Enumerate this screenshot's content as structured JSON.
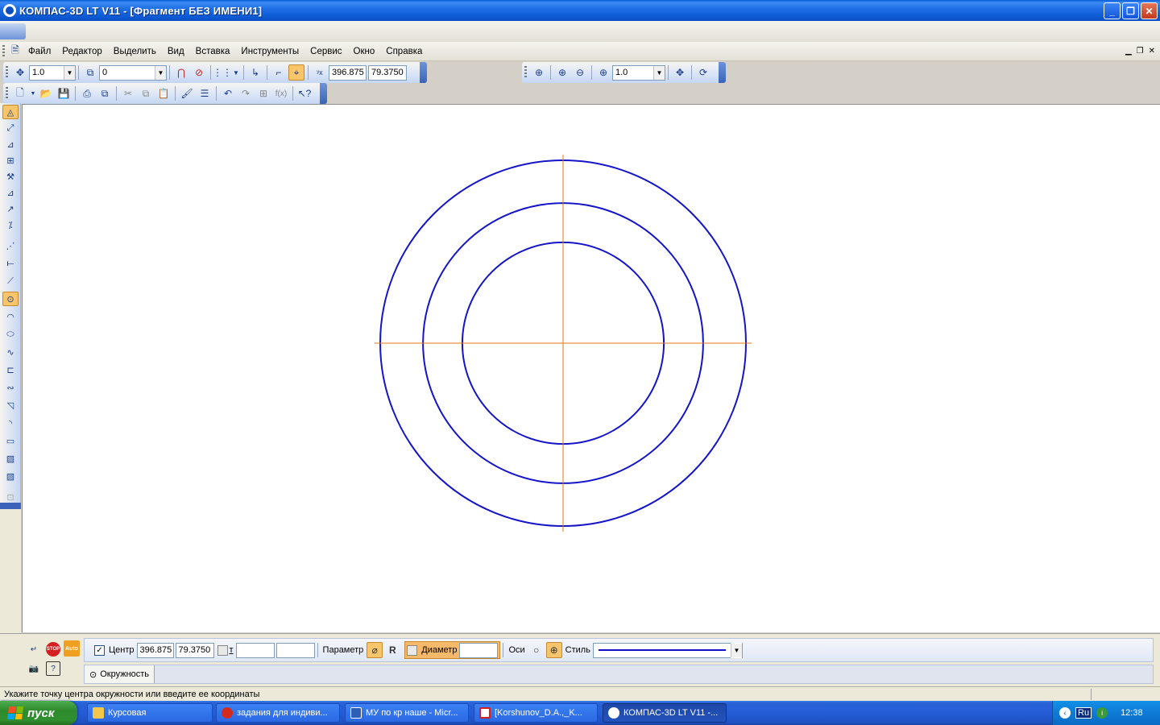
{
  "window": {
    "title": "КОМПАС-3D LT V11 - [Фрагмент БЕЗ ИМЕНИ1]",
    "controls": {
      "minimize": "_",
      "maximize": "❐",
      "close": "✕"
    }
  },
  "menu": {
    "items": [
      "Файл",
      "Редактор",
      "Выделить",
      "Вид",
      "Вставка",
      "Инструменты",
      "Сервис",
      "Окно",
      "Справка"
    ]
  },
  "toolbar_current": {
    "step": "1.0",
    "layer": "0",
    "coord_x": "396.875",
    "coord_y": "79.3750"
  },
  "toolbar_view": {
    "zoom": "1.0"
  },
  "property_panel": {
    "center_label": "Центр",
    "center_x": "396.875",
    "center_y": "79.3750",
    "point_label": "т",
    "point_x": "",
    "point_y": "",
    "parameter_label": "Параметр",
    "radius_label": "R",
    "diameter_label": "Диаметр",
    "diameter_value": "",
    "axes_label": "Оси",
    "style_label": "Стиль",
    "tab_label": "Окружность"
  },
  "status": {
    "message": "Укажите точку центра окружности или введите ее координаты"
  },
  "taskbar": {
    "start_label": "пуск",
    "tasks": [
      {
        "label": "Курсовая",
        "color": "#f3c74a"
      },
      {
        "label": "задания для индиви...",
        "color": "#d42b1e"
      },
      {
        "label": "МУ по кр наше - Micr...",
        "color": "#2b5fb8"
      },
      {
        "label": "[Korshunov_D.A.,_K...",
        "color": "#d42020"
      },
      {
        "label": "КОМПАС-3D LT V11 -...",
        "color": "#ffffff"
      }
    ],
    "lang": "RU",
    "tray_lang": "Ru",
    "clock": "12:38"
  },
  "drawing": {
    "circle_color": "#1414c8",
    "axis_color": "#e07b12",
    "circles": [
      {
        "name": "outer-circle",
        "diameter_fraction": 1.0
      },
      {
        "name": "middle-circle",
        "diameter_fraction": 0.766
      },
      {
        "name": "inner-circle",
        "diameter_fraction": 0.551
      }
    ]
  }
}
